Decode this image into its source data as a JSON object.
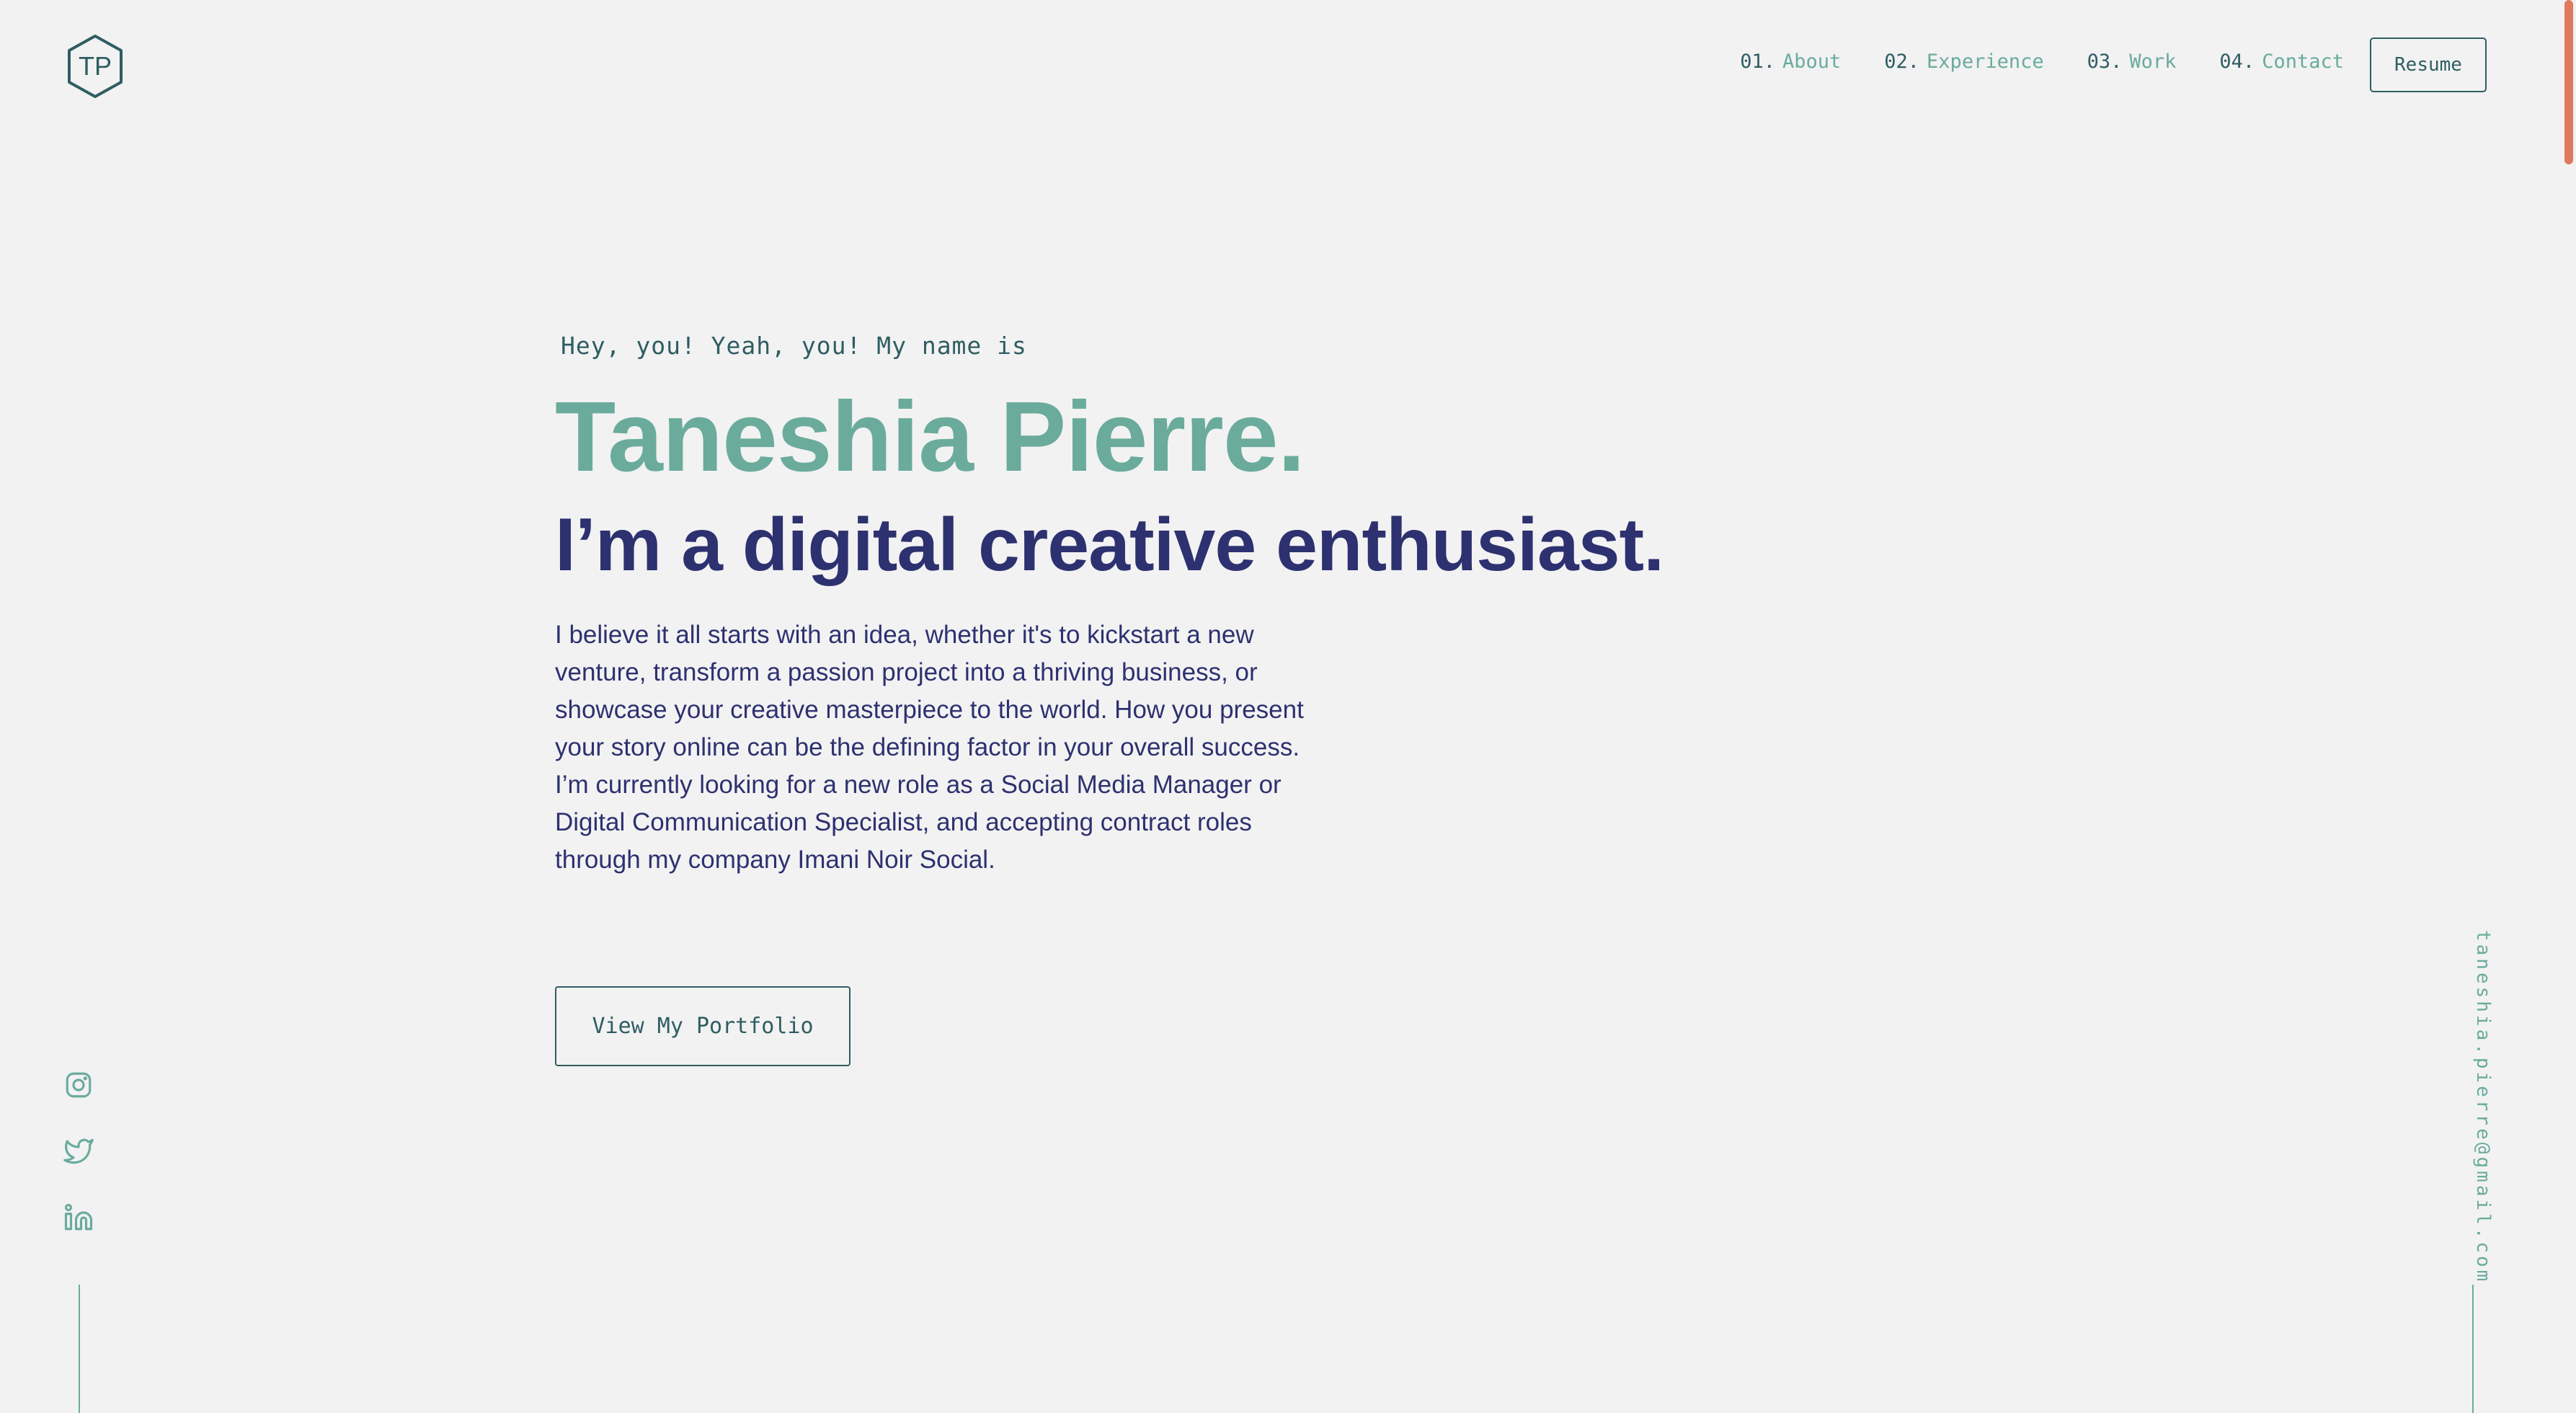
{
  "header": {
    "logo_text": "TP",
    "nav": [
      {
        "num": "01.",
        "label": "About"
      },
      {
        "num": "02.",
        "label": "Experience"
      },
      {
        "num": "03.",
        "label": "Work"
      },
      {
        "num": "04.",
        "label": "Contact"
      }
    ],
    "resume_label": "Resume"
  },
  "hero": {
    "greeting": "Hey, you! Yeah, you! My name is",
    "name": "Taneshia Pierre.",
    "tagline": "I’m a digital creative enthusiast.",
    "bio": "I believe it all starts with an idea, whether it's to kickstart a new venture, transform a passion project into a thriving business, or showcase your creative masterpiece to the world. How you present your story online can be the defining factor in your overall success. I’m currently looking for a new role as a Social Media Manager or Digital Communication Specialist, and accepting contract roles through my company Imani Noir Social.",
    "cta_label": "View My Portfolio"
  },
  "social": [
    {
      "icon": "instagram-icon"
    },
    {
      "icon": "twitter-icon"
    },
    {
      "icon": "linkedin-icon"
    }
  ],
  "email": "taneshia.pierre@gmail.com",
  "colors": {
    "background": "#f2f2f2",
    "accent_green": "#6aab9c",
    "dark_teal": "#2f5d62",
    "navy": "#2d3170",
    "scroll_accent": "#e07a5f"
  }
}
